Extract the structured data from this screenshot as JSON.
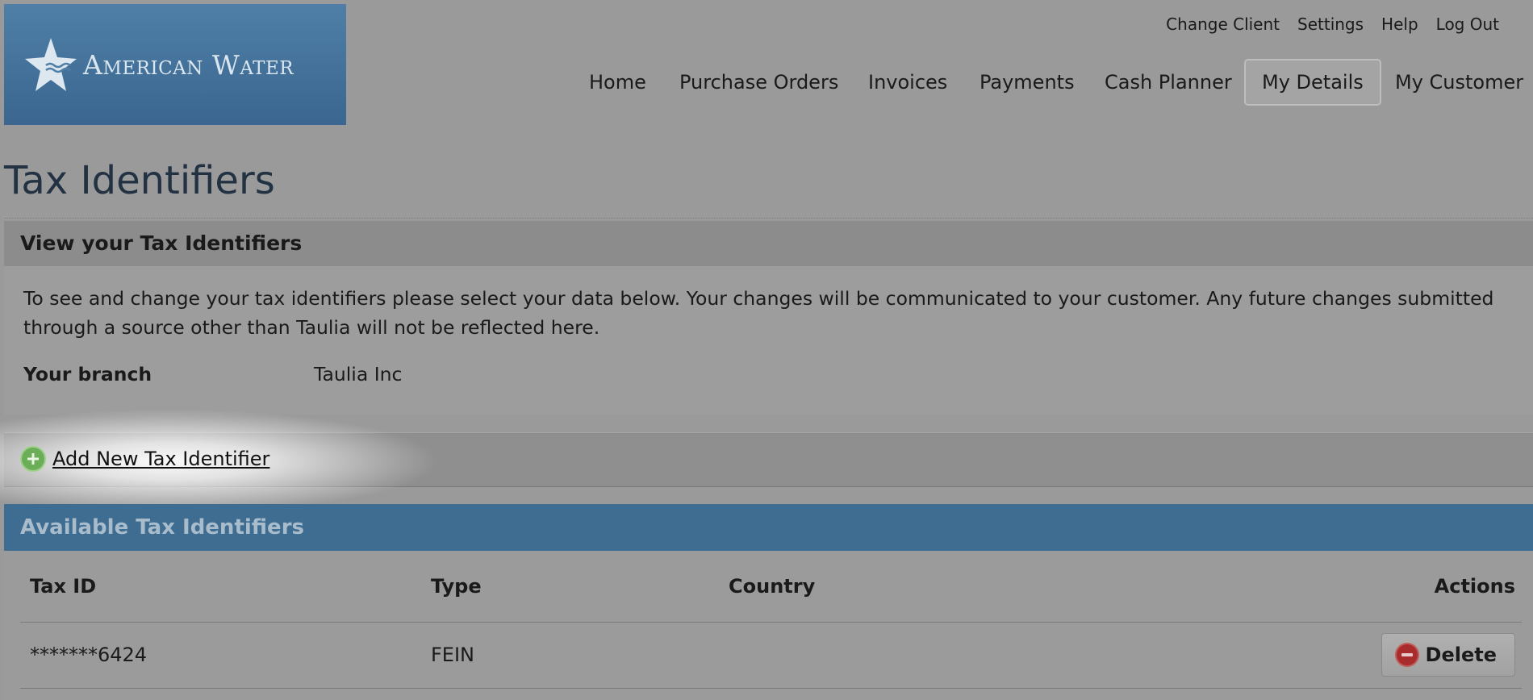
{
  "logo": {
    "text": "American Water",
    "icon": "star-waves-icon"
  },
  "util_nav": [
    {
      "label": "Change Client"
    },
    {
      "label": "Settings"
    },
    {
      "label": "Help"
    },
    {
      "label": "Log Out"
    }
  ],
  "main_nav": [
    {
      "label": "Home"
    },
    {
      "label": "Purchase Orders"
    },
    {
      "label": "Invoices"
    },
    {
      "label": "Payments"
    },
    {
      "label": "Cash Planner"
    },
    {
      "label": "My Details",
      "active": true
    },
    {
      "label": "My Customer"
    }
  ],
  "page_title": "Tax Identifiers",
  "view_panel": {
    "title": "View your Tax Identifiers",
    "description": "To see and change your tax identifiers please select your data below. Your changes will be communicated to your customer. Any future changes submitted through a source other than Taulia will not be reflected here.",
    "branch_label": "Your branch",
    "branch_value": "Taulia Inc"
  },
  "add_panel": {
    "link_label": "Add New Tax Identifier",
    "icon": "plus-circle-icon"
  },
  "available_panel": {
    "title": "Available Tax Identifiers",
    "columns": [
      "Tax ID",
      "Type",
      "Country",
      "Actions"
    ],
    "rows": [
      {
        "tax_id": "*******6424",
        "type": "FEIN",
        "country": "",
        "action_label": "Delete"
      }
    ]
  },
  "colors": {
    "brand_blue": "#3f6d91",
    "logo_blue": "#4f7fa6",
    "add_green": "#6cae57",
    "delete_red": "#a82c2c",
    "overlay_gray": "#9a9a9a"
  }
}
